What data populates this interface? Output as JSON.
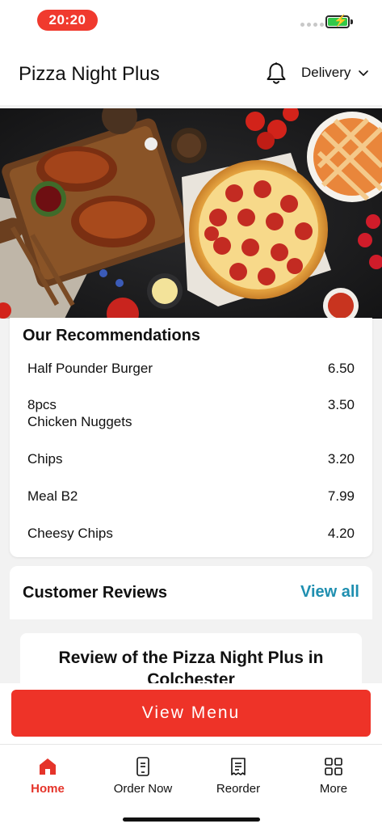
{
  "status_bar": {
    "time": "20:20"
  },
  "header": {
    "title": "Pizza Night Plus",
    "delivery_label": "Delivery"
  },
  "recommendations": {
    "title": "Our Recommendations",
    "items": [
      {
        "name": "Half Pounder Burger",
        "price": "6.50"
      },
      {
        "name": "8pcs\n Chicken Nuggets",
        "price": "3.50"
      },
      {
        "name": "Chips",
        "price": "3.20"
      },
      {
        "name": "Meal B2",
        "price": "7.99"
      },
      {
        "name": "Cheesy Chips",
        "price": "4.20"
      }
    ]
  },
  "reviews": {
    "title": "Customer Reviews",
    "view_all": "View all",
    "review_heading": "Review of the Pizza Night Plus in Colchester"
  },
  "cta": {
    "label": "View Menu"
  },
  "tabs": [
    {
      "label": "Home",
      "icon": "home-icon",
      "active": true
    },
    {
      "label": "Order Now",
      "icon": "phone-order-icon",
      "active": false
    },
    {
      "label": "Reorder",
      "icon": "receipt-icon",
      "active": false
    },
    {
      "label": "More",
      "icon": "grid-icon",
      "active": false
    }
  ],
  "colors": {
    "accent": "#ee3328",
    "link": "#1f8fb0",
    "battery": "#33c94a"
  }
}
